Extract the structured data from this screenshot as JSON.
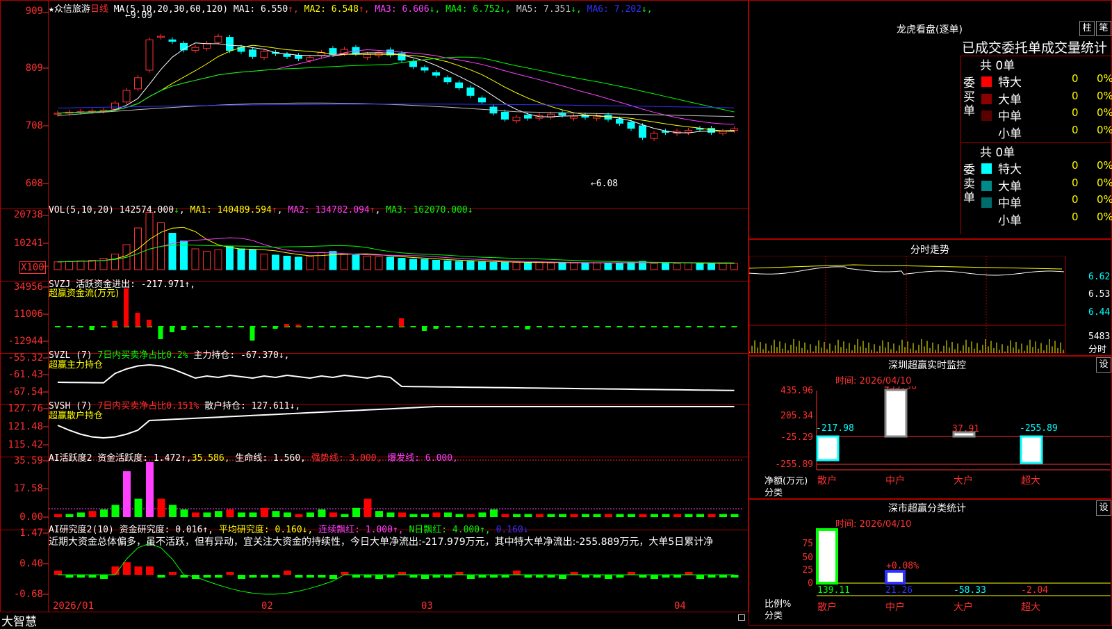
{
  "stock": {
    "star": "★",
    "name": "众信旅游",
    "period": "日线"
  },
  "ma_header": {
    "params": "MA(5,10,20,30,60,120)",
    "items": [
      {
        "label": "MA1:",
        "value": "6.550",
        "arrow": "↑",
        "color": "#ffffff"
      },
      {
        "label": "MA2:",
        "value": "6.548",
        "arrow": "↑",
        "color": "#ffff00"
      },
      {
        "label": "MA3:",
        "value": "6.606",
        "arrow": "↓",
        "color": "#ff40ff"
      },
      {
        "label": "MA4:",
        "value": "6.752",
        "arrow": "↓",
        "color": "#00ff00"
      },
      {
        "label": "MA5:",
        "value": "7.351",
        "arrow": "↓",
        "color": "#c0c0c0"
      },
      {
        "label": "MA6:",
        "value": "7.202",
        "arrow": "↓",
        "color": "#3030ff"
      }
    ]
  },
  "price_axis": [
    "909",
    "809",
    "708",
    "608"
  ],
  "price_marks": {
    "high": "9.09",
    "low": "6.08"
  },
  "vol_header": {
    "params": "VOL(5,10,20)",
    "value": "142574.000",
    "arrow": "↓",
    "ma1": "140489.594",
    "ma1_arrow": "↑",
    "ma2": "134782.094",
    "ma2_arrow": "↑",
    "ma3": "162070.000",
    "ma3_arrow": "↓"
  },
  "vol_axis": [
    "20738",
    "10241"
  ],
  "vol_unit": "X100",
  "svzj": {
    "header": "SVZJ  活跃资金进出: -217.971↑,",
    "sub": "超赢资金流(万元)",
    "axis": [
      "34956",
      "11006",
      "-12944"
    ]
  },
  "svzl": {
    "header_a": "SVZL (7) ",
    "header_b": "7日内买卖净占比0.2%",
    "header_c": " 主力持仓: -67.370↓,",
    "sub": "超赢主力持仓",
    "axis": [
      "-55.32",
      "-61.43",
      "-67.54"
    ]
  },
  "svsh": {
    "header_a": "SVSH (7) ",
    "header_b": "7日内买卖净占比0.151%",
    "header_c": " 散户持仓: 127.611↓,",
    "sub": "超赢散户持仓",
    "axis": [
      "127.76",
      "121.48",
      "115.42"
    ]
  },
  "ai1": {
    "header_a": "AI活跃度2 资金活跃度: 1.472↑,",
    "header_b": "35.586,",
    "header_c": "生命线: 1.560,",
    "header_d": "强势线: 3.000,",
    "header_e": "爆发线: 6.000,",
    "axis": [
      "35.59",
      "17.58",
      "0.00"
    ]
  },
  "ai2": {
    "header_a": "AI研究度2(10) 资金研究度: 0.016↑,",
    "header_b": "平均研究度: 0.160↓,",
    "header_c": "连续飘红: 1.000↑,",
    "header_d": "N日飘红: 4.000↑,",
    "header_e": "0.160↓",
    "text": "近期大资金总体偏多，虽不活跃，但有异动，宜关注大资金的持续性，今日大单净流出:-217.979万元，其中特大单净流出:-255.889万元，大单5日累计净",
    "axis": [
      "1.47",
      "0.40",
      "-0.68"
    ]
  },
  "date_axis": [
    "2026/01",
    "02",
    "03",
    "04"
  ],
  "brand": "大智慧",
  "longhu": {
    "title": "龙虎看盘(逐单)",
    "btn1": "柱",
    "btn2": "笔",
    "tabs": "已成交委托单成交量统计",
    "buy_label": "委买单",
    "sell_label": "委卖单",
    "buy_total": "共 0单",
    "sell_total": "共 0单",
    "buy_rows": [
      {
        "name": "特大",
        "v": "0",
        "p": "0%",
        "color": "#ff0000"
      },
      {
        "name": "大单",
        "v": "0",
        "p": "0%",
        "color": "#8b0000"
      },
      {
        "name": "中单",
        "v": "0",
        "p": "0%",
        "color": "#5a0000"
      },
      {
        "name": "小单",
        "v": "0",
        "p": "0%",
        "color": "#000000"
      }
    ],
    "sell_rows": [
      {
        "name": "特大",
        "v": "0",
        "p": "0%",
        "color": "#00ffff"
      },
      {
        "name": "大单",
        "v": "0",
        "p": "0%",
        "color": "#008b8b"
      },
      {
        "name": "中单",
        "v": "0",
        "p": "0%",
        "color": "#006b6b"
      },
      {
        "name": "小单",
        "v": "0",
        "p": "0%",
        "color": "#000000"
      }
    ]
  },
  "fenshi": {
    "title": "分时走势",
    "axis": [
      "6.62",
      "6.53",
      "6.44"
    ],
    "vol": "5483",
    "vol_unit": "分时"
  },
  "monitor": {
    "title": "深圳超赢实时监控",
    "btn": "设",
    "time": "时间: 2026/04/10",
    "axis": [
      "435.96",
      "205.34",
      "-25.29",
      "-255.89"
    ],
    "ylabel1": "净额(万元)",
    "ylabel2": "分类",
    "bars": [
      {
        "cat": "散户",
        "v": "-217.98"
      },
      {
        "cat": "中户",
        "v": "435.96"
      },
      {
        "cat": "大户",
        "v": "37.91"
      },
      {
        "cat": "超大",
        "v": "-255.89"
      }
    ]
  },
  "classify": {
    "title": "深市超赢分类统计",
    "btn": "设",
    "time": "时间: 2026/04/10",
    "axis": [
      "75",
      "50",
      "25",
      "0"
    ],
    "ylabel1": "比例%",
    "ylabel2": "分类",
    "mid_label": "+0.08%",
    "bars": [
      {
        "cat": "散户",
        "v": "139.11"
      },
      {
        "cat": "中户",
        "v": "21.26"
      },
      {
        "cat": "大户",
        "v": "-58.33"
      },
      {
        "cat": "超大",
        "v": "-2.04"
      }
    ]
  }
}
